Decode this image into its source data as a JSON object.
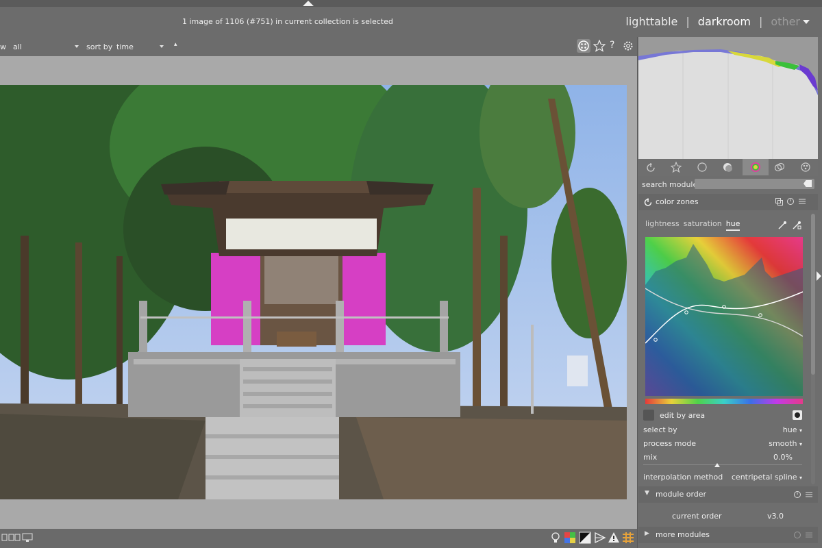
{
  "header": {
    "selection_status": "1 image of 1106 (#751) in current collection is selected",
    "views": {
      "lighttable": "lighttable",
      "separator": "|",
      "darkroom": "darkroom",
      "other": "other"
    }
  },
  "filterbar": {
    "view_prefix": "w",
    "filter_value": "all",
    "sort_label": "sort by",
    "sort_value": "time"
  },
  "toolbar_right_icons": [
    "display-grid-icon",
    "star-icon",
    "help-icon",
    "gear-icon"
  ],
  "module_groups": [
    "power-icon",
    "star-icon",
    "circle-icon",
    "sphere-icon",
    "color-icon",
    "correct-icon",
    "effect-icon"
  ],
  "search": {
    "label": "search module",
    "value": ""
  },
  "color_zones": {
    "title": "color zones",
    "tabs": [
      "lightness",
      "saturation",
      "hue"
    ],
    "selected_tab": "hue",
    "edit_by_area_label": "edit by area",
    "select_by_label": "select by",
    "select_by_value": "hue",
    "process_mode_label": "process mode",
    "process_mode_value": "smooth",
    "mix_label": "mix",
    "mix_value": "0.0%",
    "interpolation_label": "interpolation method",
    "interpolation_value": "centripetal spline"
  },
  "module_order": {
    "title": "module order",
    "current_label": "current order",
    "current_value": "v3.0"
  },
  "more_modules": {
    "title": "more modules"
  },
  "accent": "#e8e8e8"
}
